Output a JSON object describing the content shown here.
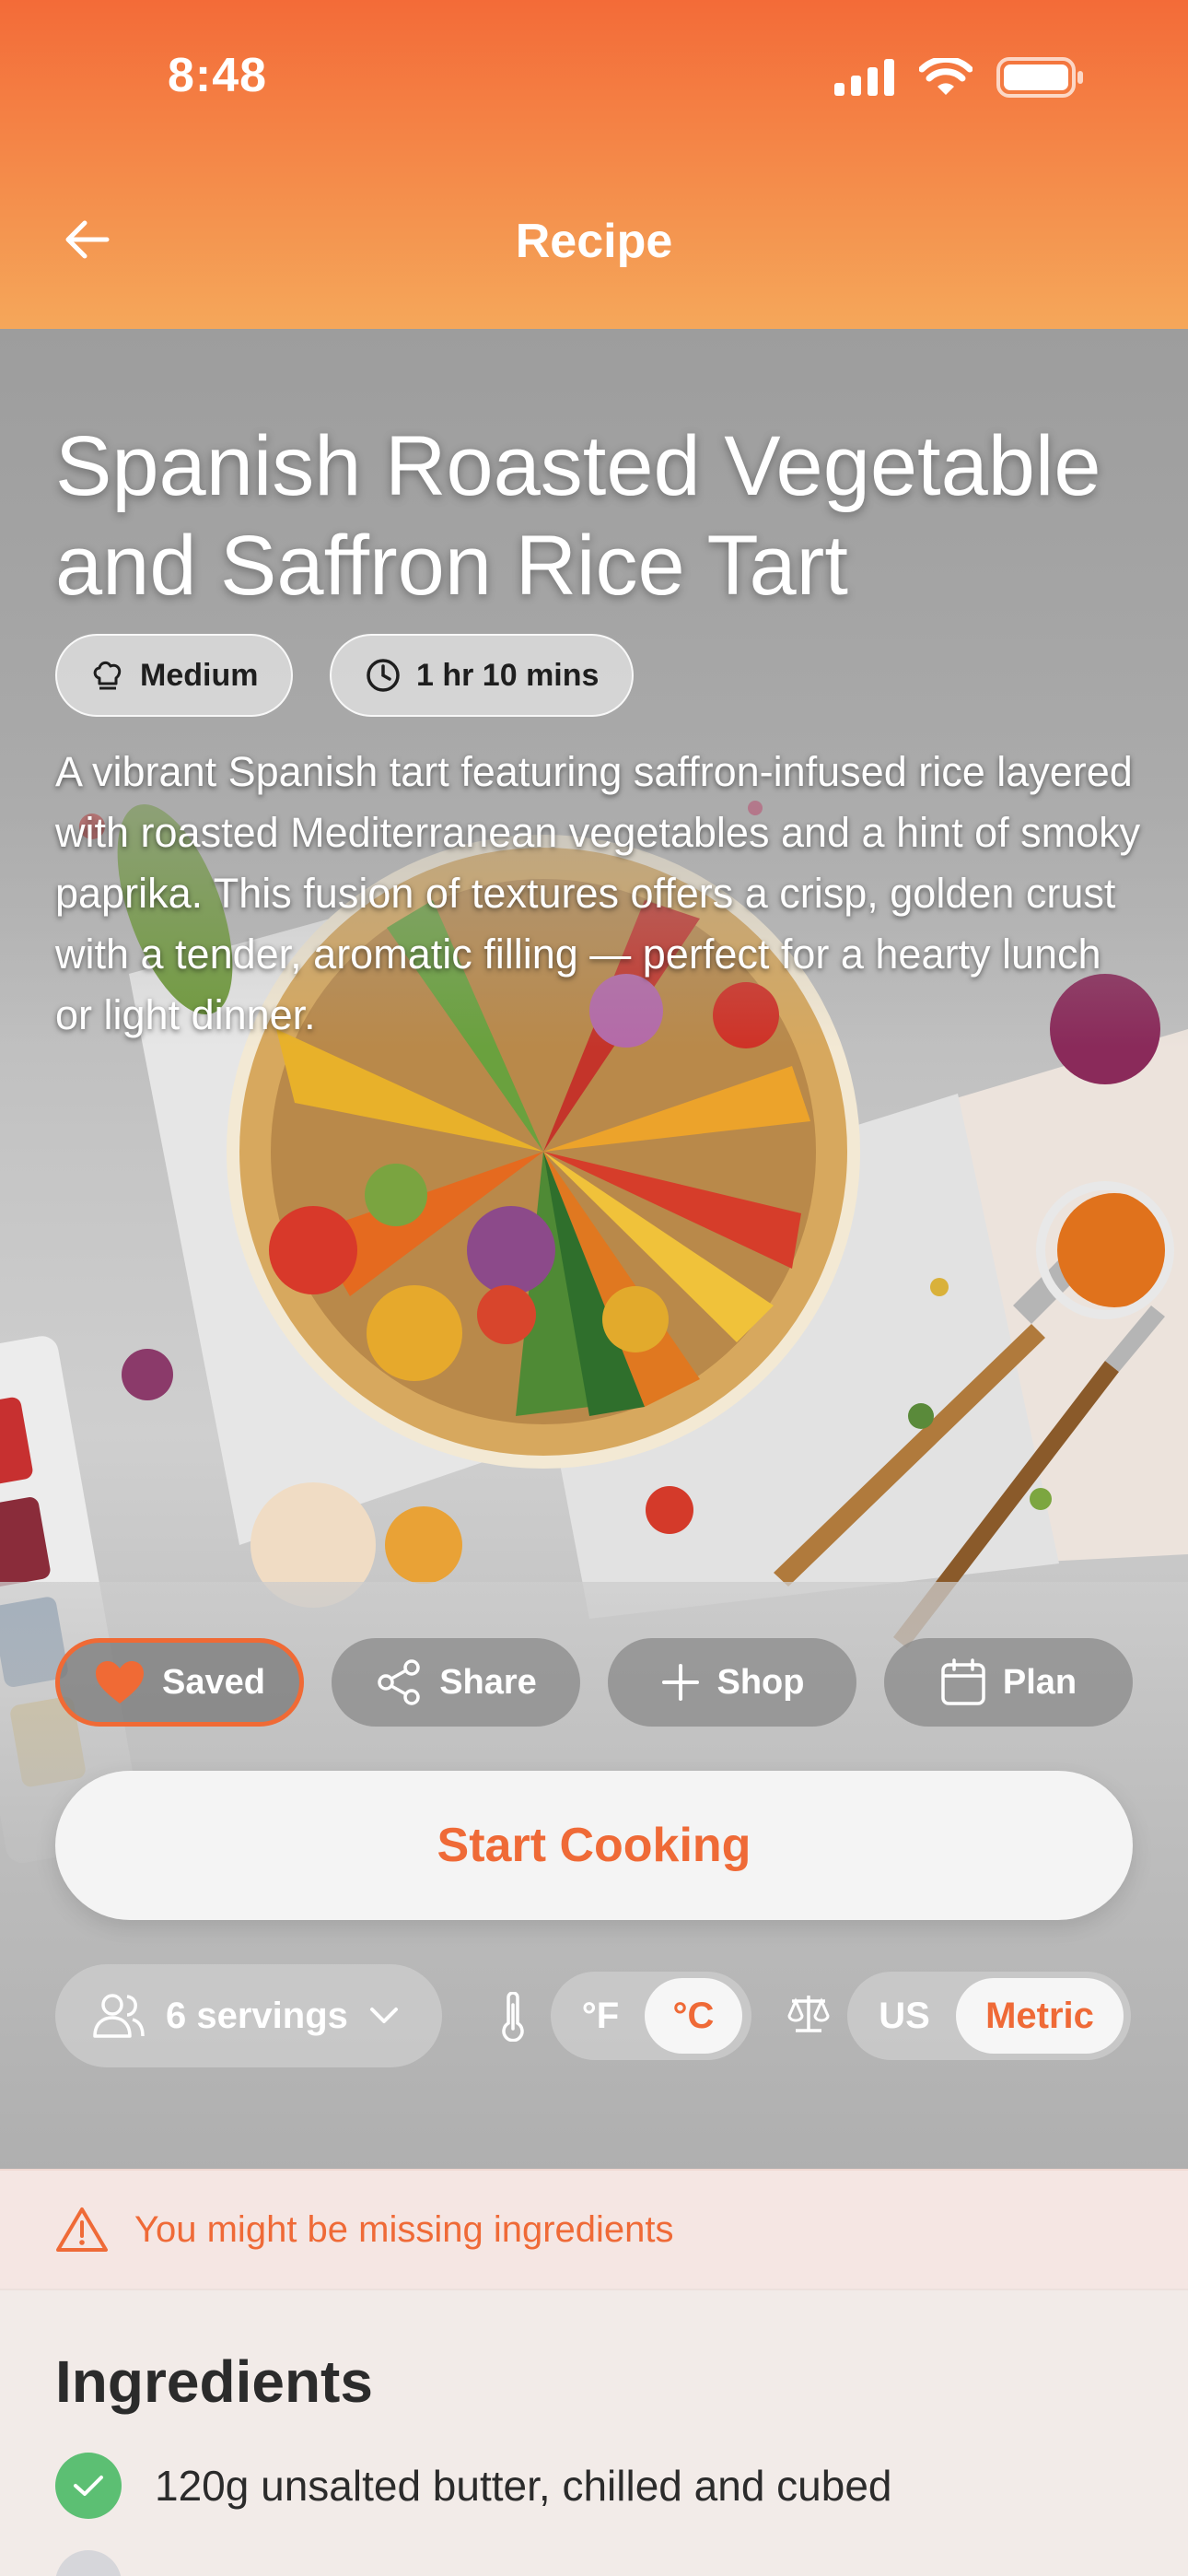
{
  "status_bar": {
    "time": "8:48"
  },
  "header": {
    "title": "Recipe"
  },
  "recipe": {
    "title": "Spanish Roasted Vegetable and Saffron Rice Tart",
    "difficulty": "Medium",
    "duration": "1 hr 10 mins",
    "description": "A vibrant Spanish tart featuring saffron-infused rice layered with roasted Mediterranean vegetables and a hint of smoky paprika. This fusion of textures offers a crisp, golden crust with a tender, aromatic filling — perfect for a hearty lunch or light dinner."
  },
  "actions": {
    "saved": "Saved",
    "share": "Share",
    "shop": "Shop",
    "plan": "Plan",
    "start": "Start Cooking"
  },
  "settings": {
    "servings": "6 servings",
    "temperature": {
      "options": [
        "°F",
        "°C"
      ],
      "selected": "°C"
    },
    "units": {
      "options": [
        "US",
        "Metric"
      ],
      "selected": "Metric"
    }
  },
  "warning": {
    "text": "You might be missing ingredients"
  },
  "ingredients": {
    "title": "Ingredients",
    "items": [
      {
        "text": "120g unsalted butter, chilled and cubed",
        "checked": true
      },
      {
        "text": "",
        "checked": false
      }
    ]
  },
  "colors": {
    "accent": "#ef6a37",
    "header_top": "#f36b38",
    "header_bottom": "#f5a75a",
    "check_green": "#5cbf73"
  }
}
